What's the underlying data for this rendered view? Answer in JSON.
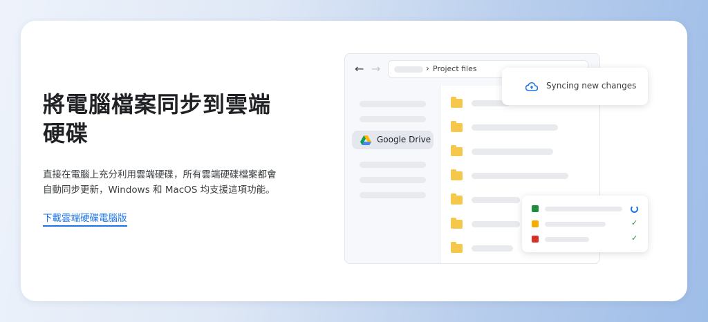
{
  "hero": {
    "title": "將電腦檔案同步到雲端硬碟",
    "description": "直接在電腦上充分利用雲端硬碟，所有雲端硬碟檔案都會自動同步更新，Windows 和 MacOS 均支援這項功能。",
    "download_link": "下載雲端硬碟電腦版"
  },
  "illustration": {
    "nav": {
      "back_icon": "arrow-back-icon",
      "forward_icon": "arrow-forward-icon"
    },
    "breadcrumb": {
      "chevron_icon": "chevron-right-icon",
      "label": "Project files"
    },
    "sidebar": {
      "drive_label": "Google Drive",
      "drive_icon": "google-drive-icon"
    },
    "sync_popup": {
      "label": "Syncing new changes",
      "icon": "cloud-sync-icon"
    },
    "uploads": [
      {
        "type": "sheets-icon",
        "color": "#1e8e3e",
        "status": "loading-spinner-icon"
      },
      {
        "type": "slides-icon",
        "color": "#f9ab00",
        "status": "check-icon"
      },
      {
        "type": "image-icon",
        "color": "#d93025",
        "status": "check-icon"
      }
    ]
  },
  "colors": {
    "accent": "#1a73e8",
    "folder": "#f5c84b",
    "check": "#1e8e3e"
  }
}
